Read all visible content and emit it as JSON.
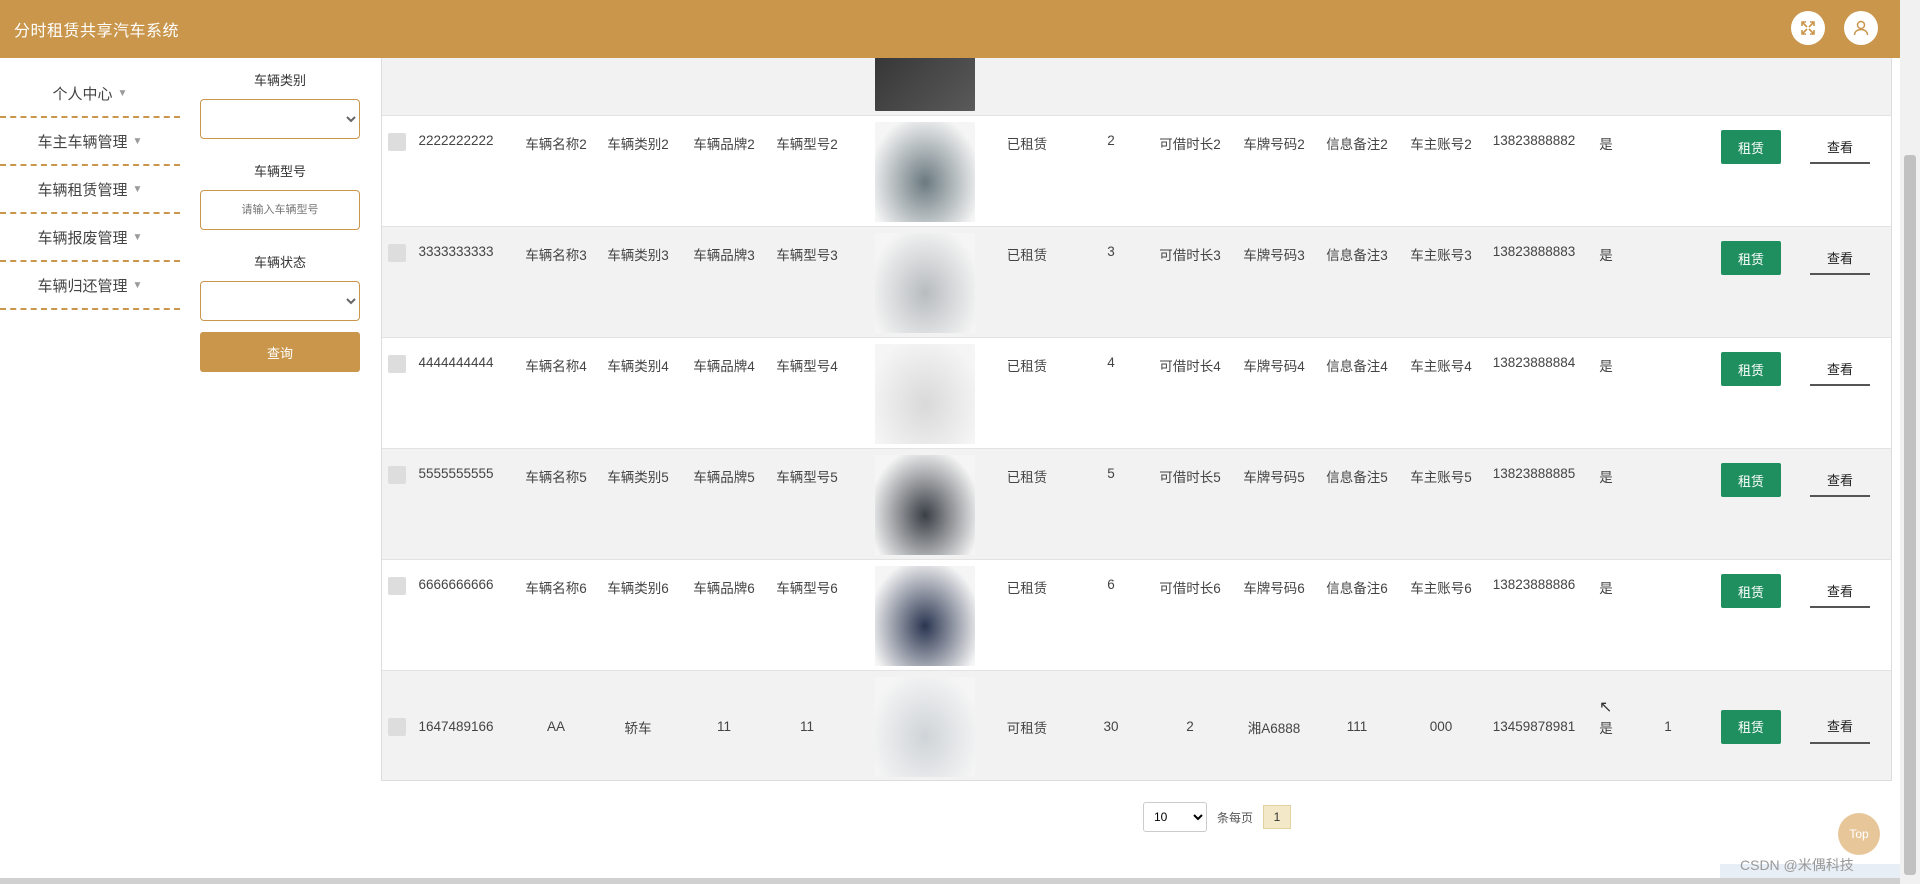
{
  "app": {
    "title": "分时租赁共享汽车系统"
  },
  "header_icons": [
    "fullscreen-icon",
    "user-icon"
  ],
  "sidebar": {
    "items": [
      {
        "label": "个人中心"
      },
      {
        "label": "车主车辆管理"
      },
      {
        "label": "车辆租赁管理"
      },
      {
        "label": "车辆报废管理"
      },
      {
        "label": "车辆归还管理"
      }
    ]
  },
  "search": {
    "category_label": "车辆类别",
    "category_value": "",
    "model_label": "车辆型号",
    "model_placeholder": "请输入车辆型号",
    "status_label": "车辆状态",
    "status_value": "",
    "query_button": "查询"
  },
  "table": {
    "rent_label": "租赁",
    "view_label": "查看",
    "rows": [
      {
        "id": "2222222222",
        "name": "车辆名称2",
        "category": "车辆类别2",
        "brand": "车辆品牌2",
        "model": "车辆型号2",
        "status": "已租赁",
        "price": "2",
        "duration": "可借时长2",
        "plate": "车牌号码2",
        "note": "信息备注2",
        "owner": "车主账号2",
        "phone": "13823888882",
        "flag": "是",
        "extra": "",
        "img_color": "#6b7a80"
      },
      {
        "id": "3333333333",
        "name": "车辆名称3",
        "category": "车辆类别3",
        "brand": "车辆品牌3",
        "model": "车辆型号3",
        "status": "已租赁",
        "price": "3",
        "duration": "可借时长3",
        "plate": "车牌号码3",
        "note": "信息备注3",
        "owner": "车主账号3",
        "phone": "13823888883",
        "flag": "是",
        "extra": "",
        "img_color": "#b8bcbf"
      },
      {
        "id": "4444444444",
        "name": "车辆名称4",
        "category": "车辆类别4",
        "brand": "车辆品牌4",
        "model": "车辆型号4",
        "status": "已租赁",
        "price": "4",
        "duration": "可借时长4",
        "plate": "车牌号码4",
        "note": "信息备注4",
        "owner": "车主账号4",
        "phone": "13823888884",
        "flag": "是",
        "extra": "",
        "img_color": "#d9d9d9"
      },
      {
        "id": "5555555555",
        "name": "车辆名称5",
        "category": "车辆类别5",
        "brand": "车辆品牌5",
        "model": "车辆型号5",
        "status": "已租赁",
        "price": "5",
        "duration": "可借时长5",
        "plate": "车牌号码5",
        "note": "信息备注5",
        "owner": "车主账号5",
        "phone": "13823888885",
        "flag": "是",
        "extra": "",
        "img_color": "#3a3f46"
      },
      {
        "id": "6666666666",
        "name": "车辆名称6",
        "category": "车辆类别6",
        "brand": "车辆品牌6",
        "model": "车辆型号6",
        "status": "已租赁",
        "price": "6",
        "duration": "可借时长6",
        "plate": "车牌号码6",
        "note": "信息备注6",
        "owner": "车主账号6",
        "phone": "13823888886",
        "flag": "是",
        "extra": "",
        "img_color": "#2a3550"
      },
      {
        "id": "1647489166",
        "name": "AA",
        "category": "轿车",
        "brand": "11",
        "model": "11",
        "status": "可租赁",
        "price": "30",
        "duration": "2",
        "plate": "湘A6888",
        "note": "111",
        "owner": "000",
        "phone": "13459878981",
        "flag": "是",
        "extra": "1",
        "img_color": "#cfd4d8"
      }
    ]
  },
  "pagination": {
    "page_size": "10",
    "per_page_label": "条每页",
    "current_page": "1"
  },
  "back_to_top": "Top",
  "watermark": "CSDN @米偶科技"
}
